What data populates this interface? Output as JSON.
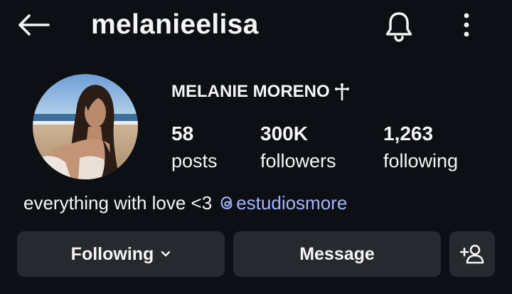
{
  "header": {
    "username": "melanieelisa",
    "back_icon": "arrow-left-icon",
    "bell_icon": "bell-icon",
    "more_icon": "more-vertical-icon"
  },
  "profile": {
    "display_name": "MELANIE MORENO",
    "name_symbol": "cross-icon",
    "stats": [
      {
        "count": "58",
        "label": "posts"
      },
      {
        "count": "300K",
        "label": "followers"
      },
      {
        "count": "1,263",
        "label": "following"
      }
    ],
    "bio_text": "everything with love <3",
    "bio_link": "estudiosmore"
  },
  "actions": {
    "following_label": "Following",
    "message_label": "Message",
    "add_user_icon": "add-user-icon"
  },
  "colors": {
    "background": "#0c1014",
    "text": "#f5f5f5",
    "button": "#26292e",
    "link": "#a5b4fc"
  }
}
